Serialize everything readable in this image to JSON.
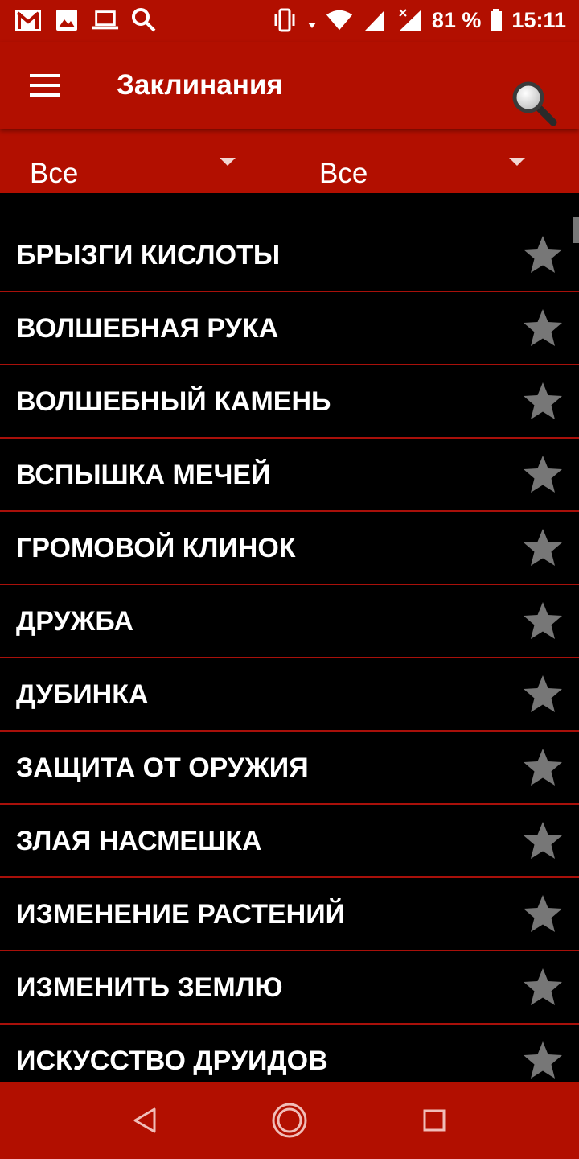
{
  "status_bar": {
    "left_icons": [
      "gmail-icon",
      "gallery-icon",
      "laptop-icon",
      "search-icon"
    ],
    "right_icons": [
      "vibrate-icon",
      "download-arrow-icon",
      "wifi-icon",
      "signal-icon",
      "signal-no-data-icon",
      "battery-icon"
    ],
    "battery": "81 %",
    "time": "15:11"
  },
  "app_bar": {
    "title": "Заклинания",
    "menu_icon": "hamburger-menu-icon",
    "search_icon": "search-icon"
  },
  "filters": [
    {
      "label": "Все",
      "icon": "dropdown-arrow-icon"
    },
    {
      "label": "Все",
      "icon": "dropdown-arrow-icon"
    }
  ],
  "spells": [
    {
      "name": "БРЫЗГИ КИСЛОТЫ",
      "favorite_icon": "star-icon"
    },
    {
      "name": "ВОЛШЕБНАЯ РУКА",
      "favorite_icon": "star-icon"
    },
    {
      "name": "ВОЛШЕБНЫЙ КАМЕНЬ",
      "favorite_icon": "star-icon"
    },
    {
      "name": "ВСПЫШКА МЕЧЕЙ",
      "favorite_icon": "star-icon"
    },
    {
      "name": "ГРОМОВОЙ КЛИНОК",
      "favorite_icon": "star-icon"
    },
    {
      "name": "ДРУЖБА",
      "favorite_icon": "star-icon"
    },
    {
      "name": "ДУБИНКА",
      "favorite_icon": "star-icon"
    },
    {
      "name": "ЗАЩИТА ОТ ОРУЖИЯ",
      "favorite_icon": "star-icon"
    },
    {
      "name": "ЗЛАЯ НАСМЕШКА",
      "favorite_icon": "star-icon"
    },
    {
      "name": "ИЗМЕНЕНИЕ РАСТЕНИЙ",
      "favorite_icon": "star-icon"
    },
    {
      "name": "ИЗМЕНИТЬ ЗЕМЛЮ",
      "favorite_icon": "star-icon"
    },
    {
      "name": "ИСКУССТВО ДРУИДОВ",
      "favorite_icon": "star-icon"
    }
  ],
  "nav_bar": {
    "icons": [
      "back-icon",
      "home-icon",
      "recents-icon"
    ]
  },
  "colors": {
    "primary": "#b20f00",
    "list_background": "#000000",
    "divider": "#a8100a",
    "star": "#777777",
    "text": "#ffffff"
  }
}
